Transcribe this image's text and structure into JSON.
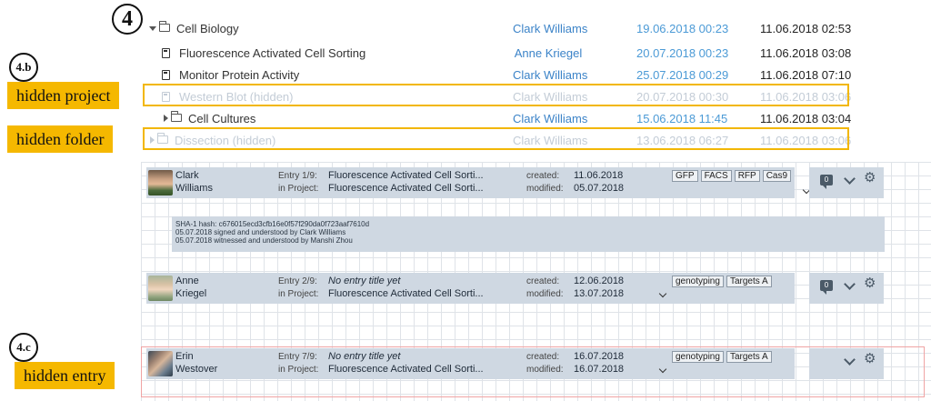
{
  "annotations": {
    "step4": "4",
    "step4b": "4.b",
    "step4c": "4.c",
    "hidden_project": "hidden project",
    "hidden_folder": "hidden folder",
    "hidden_entry": "hidden entry"
  },
  "tree": {
    "rows": [
      {
        "name": "Cell Biology",
        "owner": "Clark Williams",
        "date1": "19.06.2018 00:23",
        "date2": "11.06.2018 02:53"
      },
      {
        "name": "Fluorescence Activated Cell Sorting",
        "owner": "Anne Kriegel",
        "date1": "20.07.2018 00:23",
        "date2": "11.06.2018 03:08"
      },
      {
        "name": "Monitor Protein Activity",
        "owner": "Clark Williams",
        "date1": "25.07.2018 00:29",
        "date2": "11.06.2018 07:10"
      },
      {
        "name": "Western Blot (hidden)",
        "owner": "Clark Williams",
        "date1": "20.07.2018 00:30",
        "date2": "11.06.2018 03:06"
      },
      {
        "name": "Cell Cultures",
        "owner": "Clark Williams",
        "date1": "15.06.2018 11:45",
        "date2": "11.06.2018 03:04"
      },
      {
        "name": "Dissection (hidden)",
        "owner": "Clark Williams",
        "date1": "13.06.2018 06:27",
        "date2": "11.06.2018 03:06"
      }
    ]
  },
  "entries": [
    {
      "first": "Clark",
      "last": "Williams",
      "entry_label": "Entry 1/9:",
      "entry_title": "Fluorescence Activated Cell Sorti...",
      "project_label": "in Project:",
      "project": "Fluorescence Activated Cell Sorti...",
      "created_label": "created:",
      "created": "11.06.2018",
      "modified_label": "modified:",
      "modified": "05.07.2018",
      "tags": [
        "GFP",
        "FACS",
        "RFP",
        "Cas9"
      ],
      "comment_count": "0"
    },
    {
      "first": "Anne",
      "last": "Kriegel",
      "entry_label": "Entry 2/9:",
      "entry_title": "No entry title yet",
      "project_label": "in Project:",
      "project": "Fluorescence Activated Cell Sorti...",
      "created_label": "created:",
      "created": "12.06.2018",
      "modified_label": "modified:",
      "modified": "13.07.2018",
      "tags": [
        "genotyping",
        "Targets A"
      ],
      "comment_count": "0"
    },
    {
      "first": "Erin",
      "last": "Westover",
      "entry_label": "Entry 7/9:",
      "entry_title": "No entry title yet",
      "project_label": "in Project:",
      "project": "Fluorescence Activated Cell Sorti...",
      "created_label": "created:",
      "created": "16.07.2018",
      "modified_label": "modified:",
      "modified": "16.07.2018",
      "tags": [
        "genotyping",
        "Targets A"
      ]
    }
  ],
  "signature": {
    "line1": "SHA-1 hash: c676015ecd3cfb16e0f57f290da0f723aaf7610d",
    "line2": "05.07.2018 signed and understood by Clark Williams",
    "line3": "05.07.2018 witnessed and understood by Manshi Zhou"
  },
  "colors": {
    "highlight": "#f2b705",
    "owner_link": "#3b83c8",
    "hidden_text": "#c3ccd6",
    "entry_header_bg": "#cfd8e2",
    "hidden_entry_border": "#f0a3a3"
  }
}
